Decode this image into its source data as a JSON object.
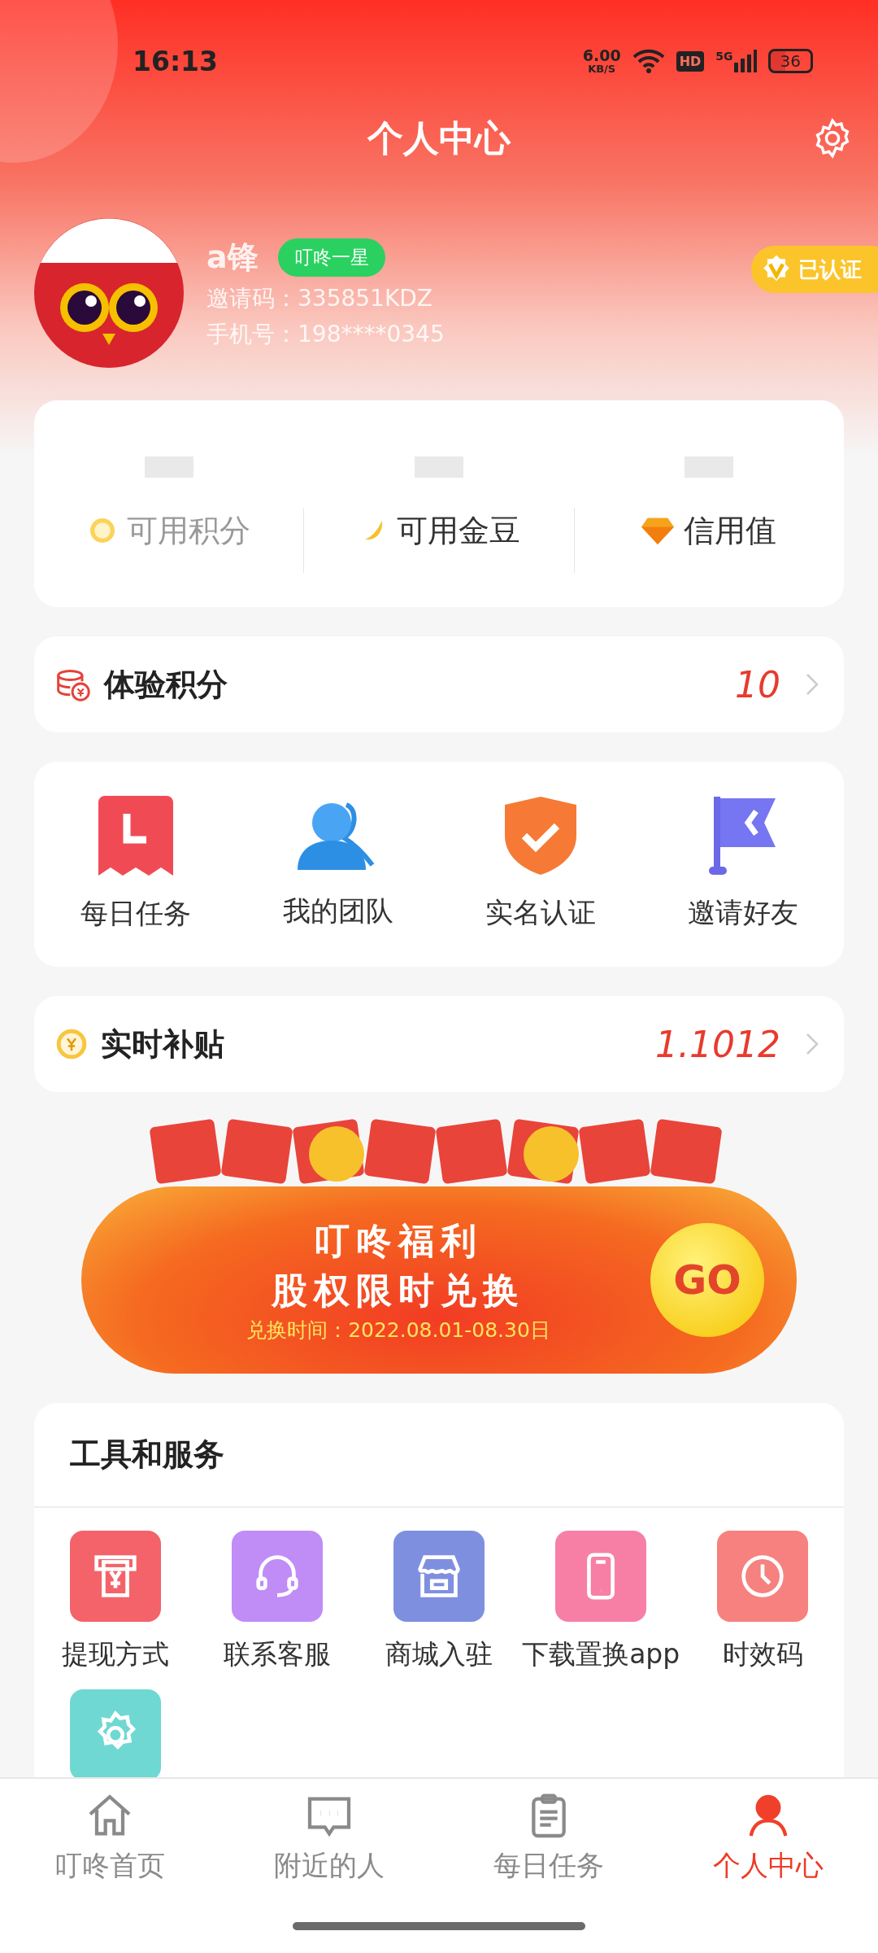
{
  "status_bar": {
    "time": "16:13",
    "net_speed": "6.00",
    "net_unit": "KB/S",
    "hd": "HD",
    "network": "5G",
    "battery": "36"
  },
  "header": {
    "title": "个人中心"
  },
  "profile": {
    "name": "a锋",
    "level_badge": "叮咚一星",
    "invite_code": "邀请码：335851KDZ",
    "phone": "手机号：198****0345",
    "verified": "已认证"
  },
  "stats": [
    {
      "label": "可用积分"
    },
    {
      "label": "可用金豆"
    },
    {
      "label": "信用值"
    }
  ],
  "experience_points": {
    "label": "体验积分",
    "value": "10"
  },
  "quick_actions": [
    {
      "label": "每日任务"
    },
    {
      "label": "我的团队"
    },
    {
      "label": "实名认证"
    },
    {
      "label": "邀请好友"
    }
  ],
  "subsidy": {
    "label": "实时补贴",
    "value": "1.1012"
  },
  "banner": {
    "title": "叮咚福利",
    "subtitle": "股权限时兑换",
    "date": "兑换时间：2022.08.01-08.30日",
    "button": "GO"
  },
  "tools": {
    "title": "工具和服务",
    "items": [
      {
        "label": "提现方式",
        "color": "#f4636a"
      },
      {
        "label": "联系客服",
        "color": "#c08cf6"
      },
      {
        "label": "商城入驻",
        "color": "#7f8fe0"
      },
      {
        "label": "下载置换app",
        "color": "#f77fa6"
      },
      {
        "label": "时效码",
        "color": "#f6817e"
      },
      {
        "color": "#6fd8d2"
      }
    ]
  },
  "tab_bar": [
    {
      "label": "叮咚首页",
      "selected": false
    },
    {
      "label": "附近的人",
      "selected": false
    },
    {
      "label": "每日任务",
      "selected": false
    },
    {
      "label": "个人中心",
      "selected": true
    }
  ]
}
